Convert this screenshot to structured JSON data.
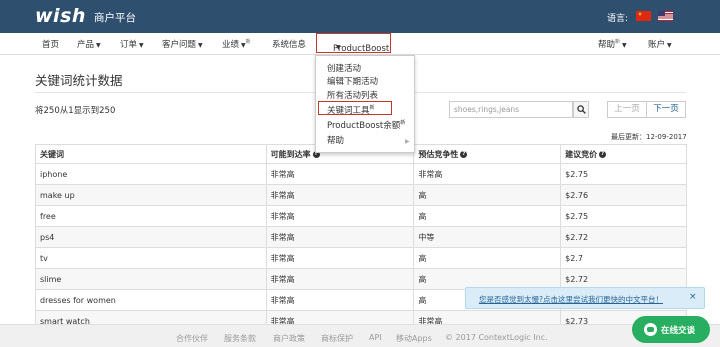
{
  "header": {
    "logo": "wish",
    "portal": "商户平台",
    "language_label": "语言:",
    "flags": [
      "cn-flag",
      "us-flag"
    ]
  },
  "nav": {
    "items": [
      {
        "label": "首页",
        "caret": false
      },
      {
        "label": "产品",
        "caret": true
      },
      {
        "label": "订单",
        "caret": true
      },
      {
        "label": "客户问题",
        "caret": true
      },
      {
        "label": "业绩",
        "caret": true,
        "badge": "新"
      },
      {
        "label": "系统信息",
        "caret": false
      },
      {
        "label": "ProductBoost",
        "caret": true,
        "active": true
      }
    ],
    "right": [
      {
        "label": "帮助",
        "badge": "新"
      },
      {
        "label": "账户",
        "caret": true
      }
    ]
  },
  "dropdown": {
    "items": [
      {
        "label": "创建活动"
      },
      {
        "label": "编辑下期活动"
      },
      {
        "label": "所有活动列表"
      },
      {
        "label": "关键词工具",
        "badge": "新",
        "highlighted": true
      },
      {
        "label": "ProductBoost余额",
        "badge": "新"
      },
      {
        "label": "帮助",
        "submenu": true
      }
    ]
  },
  "main": {
    "title": "关键词统计数据",
    "count_text": "将250从1显示到250",
    "search_placeholder": "shoes,rings,jeans",
    "prev_label": "上一页",
    "next_label": "下一页",
    "updated": "最后更新：12-09-2017"
  },
  "table": {
    "headers": [
      "关键词",
      "可能到达率",
      "预估竞争性",
      "建议竞价"
    ],
    "rows": [
      [
        "iphone",
        "非常高",
        "非常高",
        "$2.75"
      ],
      [
        "make up",
        "非常高",
        "高",
        "$2.76"
      ],
      [
        "free",
        "非常高",
        "高",
        "$2.75"
      ],
      [
        "ps4",
        "非常高",
        "中等",
        "$2.72"
      ],
      [
        "tv",
        "非常高",
        "高",
        "$2.7"
      ],
      [
        "slime",
        "非常高",
        "高",
        "$2.72"
      ],
      [
        "dresses for women",
        "非常高",
        "高",
        ""
      ],
      [
        "smart watch",
        "非常高",
        "非常高",
        "$2.73"
      ]
    ]
  },
  "banner": {
    "text": "您是否感觉到太慢?点击这里尝试我们更快的中文平台！",
    "close": "×"
  },
  "chat": {
    "label": "在线交谈"
  },
  "footer": {
    "links": [
      "合作伙伴",
      "服务条款",
      "商户政策",
      "商标保护",
      "API",
      "移动Apps",
      "© 2017 ContextLogic Inc."
    ]
  }
}
